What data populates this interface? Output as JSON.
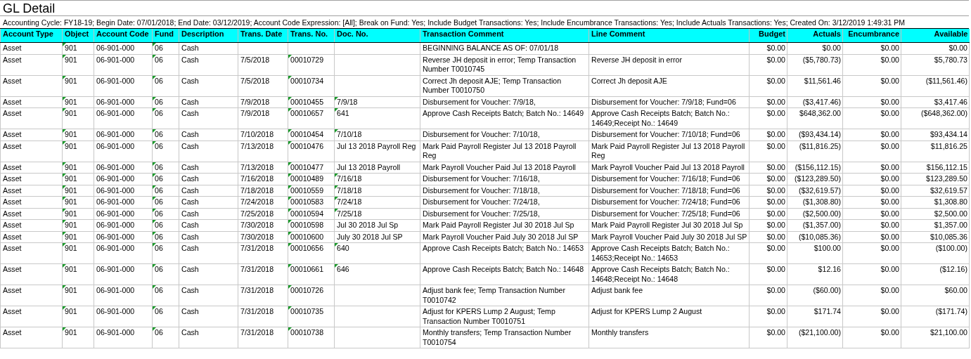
{
  "title": "GL Detail",
  "parameters": "Accounting Cycle: FY18-19; Begin Date: 07/01/2018; End Date: 03/12/2019; Account Code Expression: [All]; Break on Fund: Yes; Include Budget Transactions: Yes; Include Encumbrance Transactions: Yes; Include Actuals Transactions: Yes; Created On: 3/12/2019 1:49:31 PM",
  "table": {
    "columns": [
      "Account Type",
      "Object",
      "Account Code",
      "Fund",
      "Description",
      "Trans. Date",
      "Trans. No.",
      "Doc. No.",
      "Transaction Comment",
      "Line Comment",
      "Budget",
      "Actuals",
      "Encumbrance",
      "Available"
    ],
    "rows": [
      {
        "cells": [
          "Asset",
          "901",
          "06-901-000",
          "06",
          "Cash",
          "",
          "",
          "",
          "BEGINNING BALANCE AS OF: 07/01/18",
          "",
          "$0.00",
          "$0.00",
          "$0.00",
          "$0.00"
        ],
        "marked": [
          false,
          true,
          false,
          true,
          false,
          false,
          false,
          false,
          false,
          false,
          false,
          false,
          false,
          false
        ]
      },
      {
        "cells": [
          "Asset",
          "901",
          "06-901-000",
          "06",
          "Cash",
          "7/5/2018",
          "00010729",
          "",
          "Reverse JH deposit in error; Temp Transaction Number T0010745",
          "Reverse JH deposit in error",
          "$0.00",
          "($5,780.73)",
          "$0.00",
          "$5,780.73"
        ],
        "marked": [
          false,
          true,
          false,
          true,
          false,
          false,
          true,
          false,
          false,
          false,
          false,
          false,
          false,
          false
        ]
      },
      {
        "cells": [
          "Asset",
          "901",
          "06-901-000",
          "06",
          "Cash",
          "7/5/2018",
          "00010734",
          "",
          "Correct Jh deposit AJE; Temp Transaction Number T0010750",
          "Correct Jh deposit AJE",
          "$0.00",
          "$11,561.46",
          "$0.00",
          "($11,561.46)"
        ],
        "marked": [
          false,
          true,
          false,
          true,
          false,
          false,
          true,
          false,
          false,
          false,
          false,
          false,
          false,
          false
        ]
      },
      {
        "cells": [
          "Asset",
          "901",
          "06-901-000",
          "06",
          "Cash",
          "7/9/2018",
          "00010455",
          "7/9/18",
          "Disbursement for Voucher: 7/9/18,",
          "Disbursement for Voucher: 7/9/18; Fund=06",
          "$0.00",
          "($3,417.46)",
          "$0.00",
          "$3,417.46"
        ],
        "marked": [
          false,
          true,
          false,
          true,
          false,
          false,
          true,
          true,
          false,
          false,
          false,
          false,
          false,
          false
        ]
      },
      {
        "cells": [
          "Asset",
          "901",
          "06-901-000",
          "06",
          "Cash",
          "7/9/2018",
          "00010657",
          "641",
          "Approve Cash Receipts Batch; Batch No.: 14649",
          "Approve Cash Receipts Batch; Batch No.: 14649;Receipt No.: 14649",
          "$0.00",
          "$648,362.00",
          "$0.00",
          "($648,362.00)"
        ],
        "marked": [
          false,
          true,
          false,
          true,
          false,
          false,
          true,
          true,
          false,
          false,
          false,
          false,
          false,
          false
        ]
      },
      {
        "cells": [
          "Asset",
          "901",
          "06-901-000",
          "06",
          "Cash",
          "7/10/2018",
          "00010454",
          "7/10/18",
          "Disbursement for Voucher: 7/10/18,",
          "Disbursement for Voucher: 7/10/18; Fund=06",
          "$0.00",
          "($93,434.14)",
          "$0.00",
          "$93,434.14"
        ],
        "marked": [
          false,
          true,
          false,
          true,
          false,
          false,
          true,
          true,
          false,
          false,
          false,
          false,
          false,
          false
        ]
      },
      {
        "cells": [
          "Asset",
          "901",
          "06-901-000",
          "06",
          "Cash",
          "7/13/2018",
          "00010476",
          "Jul 13 2018 Payroll Reg",
          "Mark Paid Payroll Register Jul 13 2018 Payroll Reg",
          "Mark Paid Payroll Register Jul 13 2018 Payroll Reg",
          "$0.00",
          "($11,816.25)",
          "$0.00",
          "$11,816.25"
        ],
        "marked": [
          false,
          true,
          false,
          true,
          false,
          false,
          true,
          false,
          false,
          false,
          false,
          false,
          false,
          false
        ]
      },
      {
        "cells": [
          "Asset",
          "901",
          "06-901-000",
          "06",
          "Cash",
          "7/13/2018",
          "00010477",
          "Jul 13 2018 Payroll",
          "Mark Payroll Voucher Paid Jul 13 2018 Payroll",
          "Mark Payroll Voucher Paid Jul 13 2018 Payroll",
          "$0.00",
          "($156,112.15)",
          "$0.00",
          "$156,112.15"
        ],
        "marked": [
          false,
          true,
          false,
          true,
          false,
          false,
          true,
          false,
          false,
          false,
          false,
          false,
          false,
          false
        ]
      },
      {
        "cells": [
          "Asset",
          "901",
          "06-901-000",
          "06",
          "Cash",
          "7/16/2018",
          "00010489",
          "7/16/18",
          "Disbursement for Voucher: 7/16/18,",
          "Disbursement for Voucher: 7/16/18; Fund=06",
          "$0.00",
          "($123,289.50)",
          "$0.00",
          "$123,289.50"
        ],
        "marked": [
          false,
          true,
          false,
          true,
          false,
          false,
          true,
          true,
          false,
          false,
          false,
          false,
          false,
          false
        ]
      },
      {
        "cells": [
          "Asset",
          "901",
          "06-901-000",
          "06",
          "Cash",
          "7/18/2018",
          "00010559",
          "7/18/18",
          "Disbursement for Voucher: 7/18/18,",
          "Disbursement for Voucher: 7/18/18; Fund=06",
          "$0.00",
          "($32,619.57)",
          "$0.00",
          "$32,619.57"
        ],
        "marked": [
          false,
          true,
          false,
          true,
          false,
          false,
          true,
          true,
          false,
          false,
          false,
          false,
          false,
          false
        ]
      },
      {
        "cells": [
          "Asset",
          "901",
          "06-901-000",
          "06",
          "Cash",
          "7/24/2018",
          "00010583",
          "7/24/18",
          "Disbursement for Voucher: 7/24/18,",
          "Disbursement for Voucher: 7/24/18; Fund=06",
          "$0.00",
          "($1,308.80)",
          "$0.00",
          "$1,308.80"
        ],
        "marked": [
          false,
          true,
          false,
          true,
          false,
          false,
          true,
          true,
          false,
          false,
          false,
          false,
          false,
          false
        ]
      },
      {
        "cells": [
          "Asset",
          "901",
          "06-901-000",
          "06",
          "Cash",
          "7/25/2018",
          "00010594",
          "7/25/18",
          "Disbursement for Voucher: 7/25/18,",
          "Disbursement for Voucher: 7/25/18; Fund=06",
          "$0.00",
          "($2,500.00)",
          "$0.00",
          "$2,500.00"
        ],
        "marked": [
          false,
          true,
          false,
          true,
          false,
          false,
          true,
          true,
          false,
          false,
          false,
          false,
          false,
          false
        ]
      },
      {
        "cells": [
          "Asset",
          "901",
          "06-901-000",
          "06",
          "Cash",
          "7/30/2018",
          "00010598",
          "Jul 30 2018 Jul Sp",
          "Mark Paid Payroll Register Jul 30 2018 Jul Sp",
          "Mark Paid Payroll Register Jul 30 2018 Jul Sp",
          "$0.00",
          "($1,357.00)",
          "$0.00",
          "$1,357.00"
        ],
        "marked": [
          false,
          true,
          false,
          true,
          false,
          false,
          true,
          false,
          false,
          false,
          false,
          false,
          false,
          false
        ]
      },
      {
        "cells": [
          "Asset",
          "901",
          "06-901-000",
          "06",
          "Cash",
          "7/30/2018",
          "00010600",
          "July 30 2018 Jul SP",
          "Mark Payroll Voucher Paid July 30 2018 Jul SP",
          "Mark Payroll Voucher Paid July 30 2018 Jul SP",
          "$0.00",
          "($10,085.36)",
          "$0.00",
          "$10,085.36"
        ],
        "marked": [
          false,
          true,
          false,
          true,
          false,
          false,
          true,
          false,
          false,
          false,
          false,
          false,
          false,
          false
        ]
      },
      {
        "cells": [
          "Asset",
          "901",
          "06-901-000",
          "06",
          "Cash",
          "7/31/2018",
          "00010656",
          "640",
          "Approve Cash Receipts Batch; Batch No.: 14653",
          "Approve Cash Receipts Batch; Batch No.: 14653;Receipt No.: 14653",
          "$0.00",
          "$100.00",
          "$0.00",
          "($100.00)"
        ],
        "marked": [
          false,
          true,
          false,
          true,
          false,
          false,
          true,
          true,
          false,
          false,
          false,
          false,
          false,
          false
        ]
      },
      {
        "cells": [
          "Asset",
          "901",
          "06-901-000",
          "06",
          "Cash",
          "7/31/2018",
          "00010661",
          "646",
          "Approve Cash Receipts Batch; Batch No.: 14648",
          "Approve Cash Receipts Batch; Batch No.: 14648;Receipt No.: 14648",
          "$0.00",
          "$12.16",
          "$0.00",
          "($12.16)"
        ],
        "marked": [
          false,
          true,
          false,
          true,
          false,
          false,
          true,
          true,
          false,
          false,
          false,
          false,
          false,
          false
        ]
      },
      {
        "cells": [
          "Asset",
          "901",
          "06-901-000",
          "06",
          "Cash",
          "7/31/2018",
          "00010726",
          "",
          "Adjust bank fee; Temp Transaction Number T0010742",
          "Adjust bank fee",
          "$0.00",
          "($60.00)",
          "$0.00",
          "$60.00"
        ],
        "marked": [
          false,
          true,
          false,
          true,
          false,
          false,
          true,
          false,
          false,
          false,
          false,
          false,
          false,
          false
        ]
      },
      {
        "cells": [
          "Asset",
          "901",
          "06-901-000",
          "06",
          "Cash",
          "7/31/2018",
          "00010735",
          "",
          "Adjust for KPERS Lump 2 August; Temp Transaction Number T0010751",
          "Adjust for KPERS Lump 2 August",
          "$0.00",
          "$171.74",
          "$0.00",
          "($171.74)"
        ],
        "marked": [
          false,
          true,
          false,
          true,
          false,
          false,
          true,
          false,
          false,
          false,
          false,
          false,
          false,
          false
        ]
      },
      {
        "cells": [
          "Asset",
          "901",
          "06-901-000",
          "06",
          "Cash",
          "7/31/2018",
          "00010738",
          "",
          "Monthly transfers; Temp Transaction Number T0010754",
          "Monthly transfers",
          "$0.00",
          "($21,100.00)",
          "$0.00",
          "$21,100.00"
        ],
        "marked": [
          false,
          true,
          false,
          true,
          false,
          false,
          true,
          false,
          false,
          false,
          false,
          false,
          false,
          false
        ]
      }
    ]
  }
}
